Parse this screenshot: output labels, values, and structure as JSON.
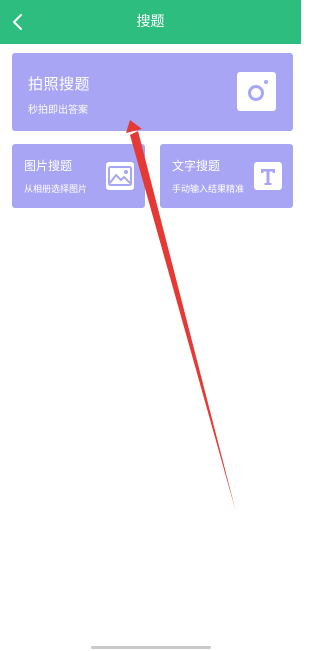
{
  "header": {
    "title": "搜题",
    "background_color": "#2dbd7e",
    "back_icon": "chevron-left-icon"
  },
  "cards": {
    "photo": {
      "title": "拍照搜题",
      "subtitle": "秒拍即出答案",
      "icon": "camera-icon"
    },
    "image": {
      "title": "图片搜题",
      "subtitle": "从相册选择图片",
      "icon": "picture-icon"
    },
    "text": {
      "title": "文字搜题",
      "subtitle": "手动输入结果精准",
      "icon": "text-t-icon"
    }
  },
  "colors": {
    "card_background": "#a8a5f4",
    "annotation_arrow": "#e53935"
  }
}
